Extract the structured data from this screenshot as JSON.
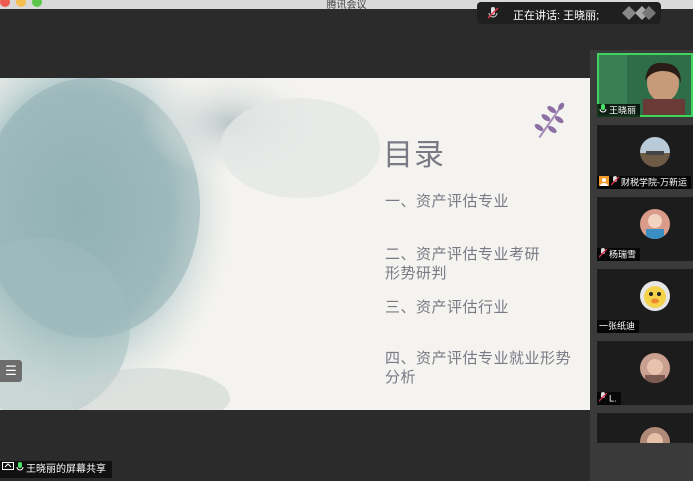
{
  "app": {
    "title": "腾讯会议"
  },
  "speaking": {
    "text": "正在讲话: 王晓丽;"
  },
  "slide": {
    "title": "目录",
    "items": [
      "一、资产评估专业",
      "二、资产评估专业考研形势研判",
      "三、资产评估行业",
      "四、资产评估专业就业形势分析"
    ],
    "menu_icon": "list-icon"
  },
  "participants": [
    {
      "name": "王晓丽",
      "active": true
    },
    {
      "name": "财税学院-万新运"
    },
    {
      "name": "杨瑞雪"
    },
    {
      "name": "一张纸迪"
    },
    {
      "name": "L."
    },
    {
      "name": ""
    }
  ],
  "share": {
    "label": "王晓丽的屏幕共享"
  },
  "colors": {
    "active_border": "#3dd65a",
    "muted_mic": "#e0324a",
    "live_mic": "#4be06a"
  }
}
